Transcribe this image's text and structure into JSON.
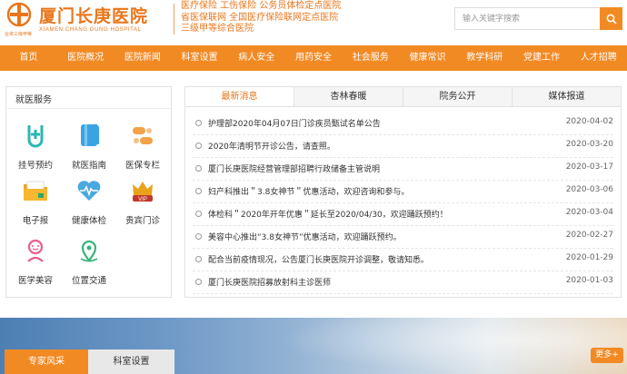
{
  "header": {
    "logo_cn": "厦门长庚医院",
    "logo_en": "XIAMEN CHANG GUNG HOSPITAL",
    "logo_badge": "台资三级甲等",
    "tagline": [
      "医疗保险 工伤保险 公务员体检定点医院",
      "省医保联网 全国医疗保险联网定点医院",
      "三级甲等综合医院"
    ],
    "search_placeholder": "输入关键字搜索",
    "accent": "#f28a24"
  },
  "nav": {
    "items": [
      "首页",
      "医院概况",
      "医院新闻",
      "科室设置",
      "病人安全",
      "用药安全",
      "社会服务",
      "健康常识",
      "教学科研",
      "党建工作",
      "人才招聘"
    ]
  },
  "services": {
    "title": "就医服务",
    "items": [
      {
        "label": "挂号预约",
        "icon": "registration-icon"
      },
      {
        "label": "就医指南",
        "icon": "guide-book-icon"
      },
      {
        "label": "医保专栏",
        "icon": "insurance-icon"
      },
      {
        "label": "电子报",
        "icon": "folder-icon"
      },
      {
        "label": "健康体检",
        "icon": "heart-icon"
      },
      {
        "label": "贵宾门诊",
        "icon": "vip-icon"
      },
      {
        "label": "医学美容",
        "icon": "beauty-icon"
      },
      {
        "label": "位置交通",
        "icon": "location-icon"
      }
    ]
  },
  "news": {
    "tabs": [
      "最新消息",
      "杏林春暖",
      "院务公开",
      "媒体报道"
    ],
    "active_tab": 0,
    "items": [
      {
        "title": "护理部2020年04月07日门诊疾员甄试名单公告",
        "date": "2020-04-02"
      },
      {
        "title": "2020年清明节开诊公告，请查照。",
        "date": "2020-03-20"
      },
      {
        "title": "厦门长庚医院经营管理部招聘行政储备主管说明",
        "date": "2020-03-17"
      },
      {
        "title": "妇产科推出＂3.8女神节＂优惠活动，欢迎咨询和参与。",
        "date": "2020-03-06"
      },
      {
        "title": "体检科＂2020年开年优惠＂延长至2020/04/30，欢迎踊跃预约！",
        "date": "2020-03-04"
      },
      {
        "title": "美容中心推出“3.8女神节”优惠活动，欢迎踊跃预约。",
        "date": "2020-02-27"
      },
      {
        "title": "配合当前疫情现况，公告厦门长庚医院开诊调整，敬请知悉。",
        "date": "2020-01-29"
      },
      {
        "title": "厦门长庚医院招募放射科主诊医师",
        "date": "2020-01-03"
      }
    ]
  },
  "bottom": {
    "tabs": [
      "专家风采",
      "科室设置"
    ],
    "more_label": "更多+"
  }
}
